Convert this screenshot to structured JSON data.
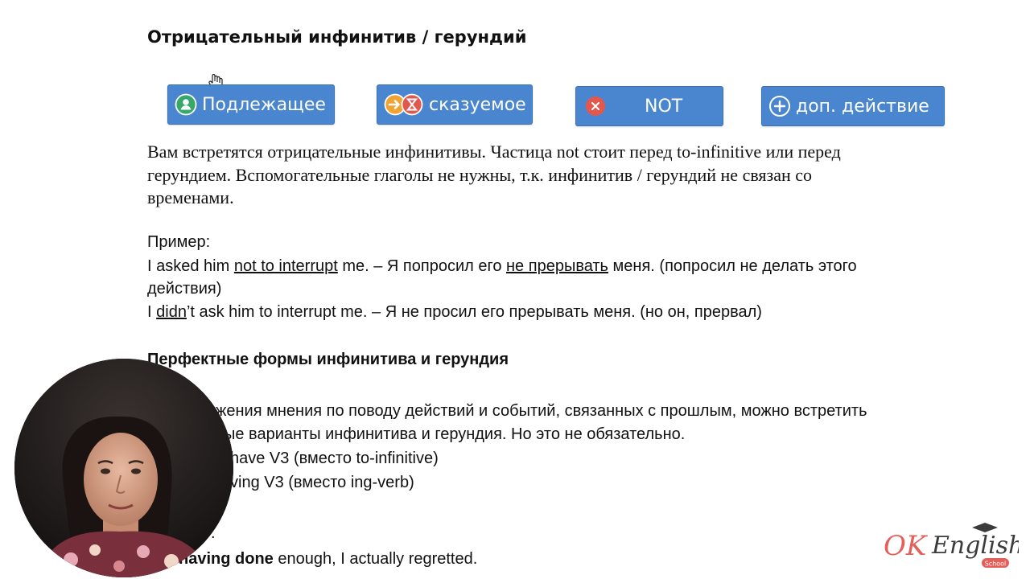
{
  "heading": "Отрицательный инфинитив / герундий",
  "role_buttons": [
    {
      "label": "Подлежащее",
      "icon": "person-icon"
    },
    {
      "label": "сказуемое",
      "icon": "arrow-hourglass-icon"
    },
    {
      "label": "NOT",
      "icon": "cross-icon"
    },
    {
      "label": "доп. действие",
      "icon": "plus-icon"
    }
  ],
  "paragraph_lines": [
    "Вам встретятся отрицательные инфинитивы. Частица not стоит перед to-infinitive или перед",
    "герундием. Вспомогательные глаголы не нужны, т.к. инфинитив / герундий не связан со",
    "временами."
  ],
  "example": {
    "label": "Пример:",
    "line1": {
      "a": "I asked him ",
      "u1": "not to interrupt",
      "b": " me. – Я попросил его ",
      "u2": "не прерывать",
      "c": " меня. (попросил не делать этого"
    },
    "line1_cont": "действия)",
    "line2": {
      "a": "I ",
      "u1": "didn",
      "b": "’t ask him to interrupt me. – Я не просил его прерывать меня. (но он, прервал)"
    }
  },
  "heading2": "Перфектные формы инфинитива и герундия",
  "perfect_lines": [
    "жения мнения по поводу действий и событий, связанных с прошлым, можно встретить",
    "ые варианты инфинитива и герундия. Но это не обязательно.",
    "have V3 (вместо to-infinitive)",
    "ving V3 (вместо ing-verb)",
    "."
  ],
  "last_line": {
    "bold": "having done",
    "rest": " enough, I actually regretted."
  },
  "logo": {
    "ok": "OK",
    "english": "English",
    "school": "School"
  },
  "colors": {
    "button_bg": "#4a86d0",
    "logo_ok": "#e3605a",
    "logo_english": "#3b3b3b"
  }
}
